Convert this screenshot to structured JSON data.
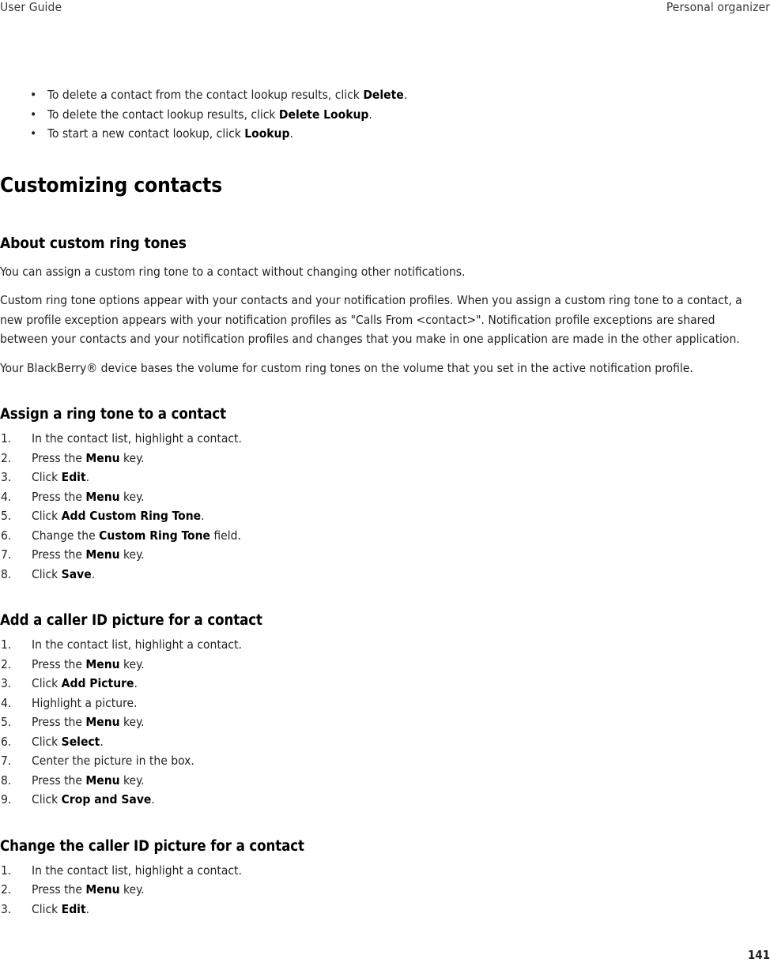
{
  "header": {
    "left": "User Guide",
    "right": "Personal organizer"
  },
  "intro_bullets": [
    {
      "marker": "•",
      "parts": [
        {
          "text": "To delete a contact from the contact lookup results, click ",
          "bold": false
        },
        {
          "text": "Delete",
          "bold": true
        },
        {
          "text": ".",
          "bold": false
        }
      ]
    },
    {
      "marker": "•",
      "parts": [
        {
          "text": "To delete the contact lookup results, click ",
          "bold": false
        },
        {
          "text": "Delete Lookup",
          "bold": true
        },
        {
          "text": ".",
          "bold": false
        }
      ]
    },
    {
      "marker": "•",
      "parts": [
        {
          "text": "To start a new contact lookup, click ",
          "bold": false
        },
        {
          "text": "Lookup",
          "bold": true
        },
        {
          "text": ".",
          "bold": false
        }
      ]
    }
  ],
  "chapter_title": "Customizing contacts",
  "section": {
    "title": "About custom ring tones",
    "paragraphs": [
      "You can assign a custom ring tone to a contact without changing other notifications.",
      "Custom ring tone options appear with your contacts and your notification profiles. When you assign a custom ring tone to a contact, a new profile exception appears with your notification profiles as \"Calls From <contact>\". Notification profile exceptions are shared between your contacts and your notification profiles and changes that you make in one application are made in the other application.",
      "Your BlackBerry® device bases the volume for custom ring tones on the volume that you set in the active notification profile."
    ]
  },
  "tasks": [
    {
      "title": "Assign a ring tone to a contact",
      "steps": [
        {
          "num": "1.",
          "parts": [
            {
              "text": "In the contact list, highlight a contact.",
              "bold": false
            }
          ]
        },
        {
          "num": "2.",
          "parts": [
            {
              "text": "Press the ",
              "bold": false
            },
            {
              "text": "Menu",
              "bold": true
            },
            {
              "text": " key.",
              "bold": false
            }
          ]
        },
        {
          "num": "3.",
          "parts": [
            {
              "text": "Click ",
              "bold": false
            },
            {
              "text": "Edit",
              "bold": true
            },
            {
              "text": ".",
              "bold": false
            }
          ]
        },
        {
          "num": "4.",
          "parts": [
            {
              "text": "Press the ",
              "bold": false
            },
            {
              "text": "Menu",
              "bold": true
            },
            {
              "text": " key.",
              "bold": false
            }
          ]
        },
        {
          "num": "5.",
          "parts": [
            {
              "text": "Click ",
              "bold": false
            },
            {
              "text": "Add Custom Ring Tone",
              "bold": true
            },
            {
              "text": ".",
              "bold": false
            }
          ]
        },
        {
          "num": "6.",
          "parts": [
            {
              "text": "Change the ",
              "bold": false
            },
            {
              "text": "Custom Ring Tone",
              "bold": true
            },
            {
              "text": " field.",
              "bold": false
            }
          ]
        },
        {
          "num": "7.",
          "parts": [
            {
              "text": "Press the ",
              "bold": false
            },
            {
              "text": "Menu",
              "bold": true
            },
            {
              "text": " key.",
              "bold": false
            }
          ]
        },
        {
          "num": "8.",
          "parts": [
            {
              "text": "Click ",
              "bold": false
            },
            {
              "text": "Save",
              "bold": true
            },
            {
              "text": ".",
              "bold": false
            }
          ]
        }
      ]
    },
    {
      "title": "Add a caller ID picture for a contact",
      "steps": [
        {
          "num": "1.",
          "parts": [
            {
              "text": "In the contact list, highlight a contact.",
              "bold": false
            }
          ]
        },
        {
          "num": "2.",
          "parts": [
            {
              "text": "Press the ",
              "bold": false
            },
            {
              "text": "Menu",
              "bold": true
            },
            {
              "text": " key.",
              "bold": false
            }
          ]
        },
        {
          "num": "3.",
          "parts": [
            {
              "text": "Click ",
              "bold": false
            },
            {
              "text": "Add Picture",
              "bold": true
            },
            {
              "text": ".",
              "bold": false
            }
          ]
        },
        {
          "num": "4.",
          "parts": [
            {
              "text": "Highlight a picture.",
              "bold": false
            }
          ]
        },
        {
          "num": "5.",
          "parts": [
            {
              "text": "Press the ",
              "bold": false
            },
            {
              "text": "Menu",
              "bold": true
            },
            {
              "text": " key.",
              "bold": false
            }
          ]
        },
        {
          "num": "6.",
          "parts": [
            {
              "text": "Click ",
              "bold": false
            },
            {
              "text": "Select",
              "bold": true
            },
            {
              "text": ".",
              "bold": false
            }
          ]
        },
        {
          "num": "7.",
          "parts": [
            {
              "text": "Center the picture in the box.",
              "bold": false
            }
          ]
        },
        {
          "num": "8.",
          "parts": [
            {
              "text": "Press the ",
              "bold": false
            },
            {
              "text": "Menu",
              "bold": true
            },
            {
              "text": " key.",
              "bold": false
            }
          ]
        },
        {
          "num": "9.",
          "parts": [
            {
              "text": "Click ",
              "bold": false
            },
            {
              "text": "Crop and Save",
              "bold": true
            },
            {
              "text": ".",
              "bold": false
            }
          ]
        }
      ]
    },
    {
      "title": "Change the caller ID picture for a contact",
      "steps": [
        {
          "num": "1.",
          "parts": [
            {
              "text": "In the contact list, highlight a contact.",
              "bold": false
            }
          ]
        },
        {
          "num": "2.",
          "parts": [
            {
              "text": "Press the ",
              "bold": false
            },
            {
              "text": "Menu",
              "bold": true
            },
            {
              "text": " key.",
              "bold": false
            }
          ]
        },
        {
          "num": "3.",
          "parts": [
            {
              "text": "Click ",
              "bold": false
            },
            {
              "text": "Edit",
              "bold": true
            },
            {
              "text": ".",
              "bold": false
            }
          ]
        }
      ]
    }
  ],
  "folio": "141"
}
